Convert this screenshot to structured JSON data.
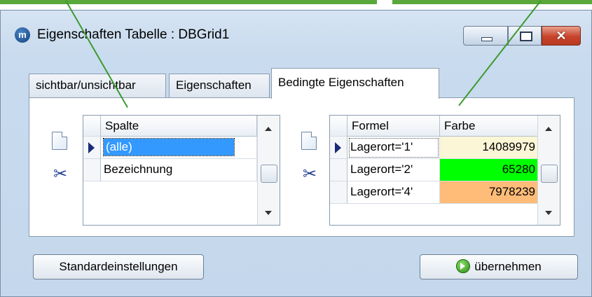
{
  "window": {
    "title": "Eigenschaften Tabelle : DBGrid1",
    "app_icon_letter": "m"
  },
  "tabs": [
    {
      "label": "sichtbar/unsichtbar",
      "active": false
    },
    {
      "label": "Eigenschaften",
      "active": false
    },
    {
      "label": "Bedingte Eigenschaften",
      "active": true
    }
  ],
  "left_grid": {
    "header": "Spalte",
    "rows": [
      {
        "value": "(alle)",
        "selected": true
      },
      {
        "value": "Bezeichnung",
        "selected": false
      }
    ]
  },
  "right_grid": {
    "headers": [
      "Formel",
      "Farbe"
    ],
    "rows": [
      {
        "formel": "Lagerort='1'",
        "farbe": "14089979",
        "color": "#fbf6d6",
        "current": true
      },
      {
        "formel": "Lagerort='2'",
        "farbe": "65280",
        "color": "#00ff00",
        "current": false
      },
      {
        "formel": "Lagerort='4'",
        "farbe": "7978239",
        "color": "#ffbc79",
        "current": false
      }
    ]
  },
  "buttons": {
    "defaults": "Standardeinstellungen",
    "apply": "übernehmen"
  },
  "colors": {
    "selection": "#3399ff",
    "accent_pointer": "#3c9a2f",
    "window_bg": "#c9dbee"
  }
}
